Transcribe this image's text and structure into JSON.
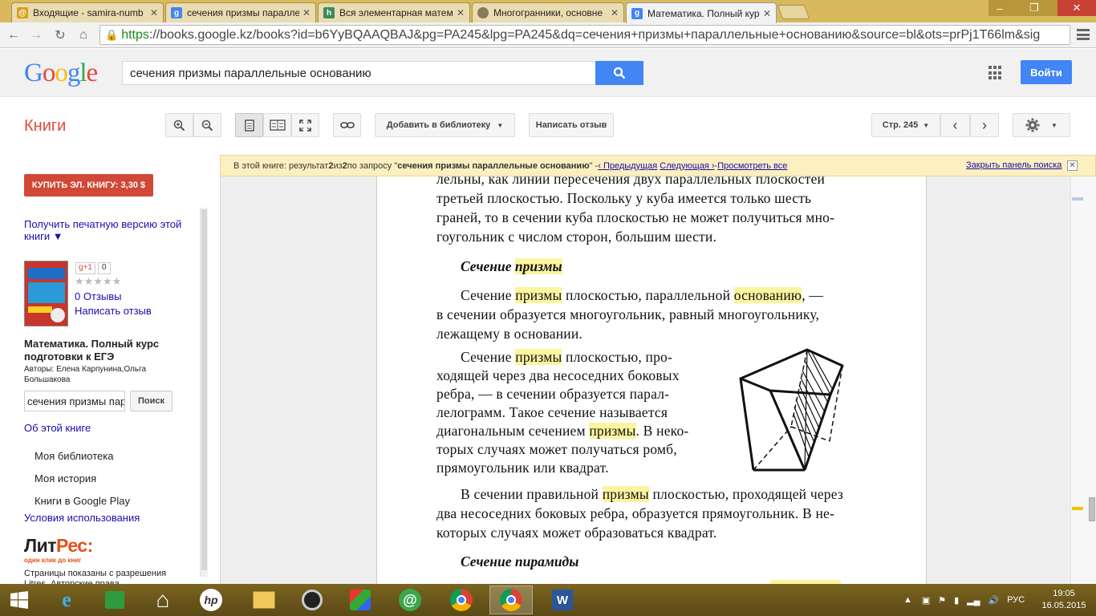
{
  "browser": {
    "tabs": [
      {
        "title": "Входящие - samira-numb",
        "icon": "mail-tab-icon",
        "color": "#d6a21e"
      },
      {
        "title": "сечения призмы паралле",
        "icon": "google-tab-icon",
        "color": "#4285f4"
      },
      {
        "title": "Вся элементарная матем",
        "icon": "site-tab-icon",
        "color": "#3b8a5c"
      },
      {
        "title": "Многогранники, основне",
        "icon": "orb-tab-icon",
        "color": "#8a7a5a"
      },
      {
        "title": "Математика. Полный кур",
        "icon": "google-tab-icon",
        "color": "#4285f4"
      }
    ],
    "url_protocol": "https",
    "url_rest": "://books.google.kz/books?id=b6YyBQAAQBAJ&pg=PA245&lpg=PA245&dq=сечения+призмы+параллельные+основанию&source=bl&ots=prPj1T66lm&sig"
  },
  "google": {
    "logo": "Google",
    "search_query": "сечения призмы параллельные основанию",
    "signin_label": "Войти"
  },
  "books_toolbar": {
    "section": "Книги",
    "add_library": "Добавить в библиотеку",
    "write_review": "Написать отзыв",
    "page_label": "Стр. 245"
  },
  "sidebar": {
    "buy_label": "КУПИТЬ ЭЛ. КНИГУ: 3,30 $",
    "print_version": "Получить печатную версию этой книги ▼",
    "gplus": "g+1",
    "gplus_count": "0",
    "stars": "★★★★★",
    "reviews": "0 Отзывы",
    "write_review": "Написать отзыв",
    "book_title": "Математика. Полный курс подготовки к ЕГЭ",
    "authors": "Авторы: Елена Карпунина,Ольга Большакова",
    "search_value": "сечения призмы пар",
    "search_btn": "Поиск",
    "about": "Об этой книге",
    "my_library": "Моя библиотека",
    "my_history": "Моя история",
    "play_books": "Книги в Google Play",
    "terms": "Условия использования",
    "litres_a": "Лит",
    "litres_b": "Рес:",
    "litres_sub": "один клик до книг",
    "pages_shown": "Страницы показаны с разрешения Litres. Авторские права"
  },
  "results_bar": {
    "prefix": "В этой книге: результат ",
    "n": "2",
    "mid": " из ",
    "total": "2",
    "query_pre": " по запросу \"",
    "query": "сечения призмы параллельные основанию",
    "query_post": "\"  -  ",
    "prev": "‹ Предыдущая",
    "next": "Следующая ›",
    "dash": "  -  ",
    "view_all": "Просмотреть все",
    "close_panel": "Закрыть панель поиска"
  },
  "page": {
    "top_lines": [
      "лельны, как линии пересечения двух параллельных плоскостей",
      "третьей плоскостью. Поскольку у куба имеется только шесть",
      "граней, то в сечении куба плоскостью не может получиться мно-",
      "гоугольник с числом сторон, большим шести."
    ],
    "heading1_a": "Сечение ",
    "heading1_b": "призмы",
    "p1_a": "Сечение ",
    "p1_b": "призмы",
    "p1_c": " плоскостью, параллельной ",
    "p1_d": "основанию",
    "p1_e": ", —",
    "p1_lines": [
      "в сечении образуется многоугольник, равный многоугольнику,",
      "лежащему в основании."
    ],
    "p2_a": "Сечение ",
    "p2_b": "призмы",
    "p2_c": " плоскостью, про-",
    "p2_lines": [
      "ходящей через два несоседних боковых",
      "ребра, — в сечении образуется парал-",
      "лелограмм. Такое сечение называется"
    ],
    "p2_d": "диагональным сечением ",
    "p2_e": "призмы",
    "p2_f": ". В неко-",
    "p2_lines2": [
      "торых случаях может получаться ромб,",
      "прямоугольник или квадрат."
    ],
    "p3_a": "В сечении правильной ",
    "p3_b": "призмы",
    "p3_c": " плоскостью, проходящей через",
    "p3_lines": [
      "два несоседних боковых ребра, образуется прямоугольник. В не-",
      "которых случаях может образоваться квадрат."
    ],
    "heading2": "Сечение пирамиды"
  },
  "taskbar": {
    "lang": "РУС",
    "time": "19:05",
    "date": "16.05.2015"
  }
}
